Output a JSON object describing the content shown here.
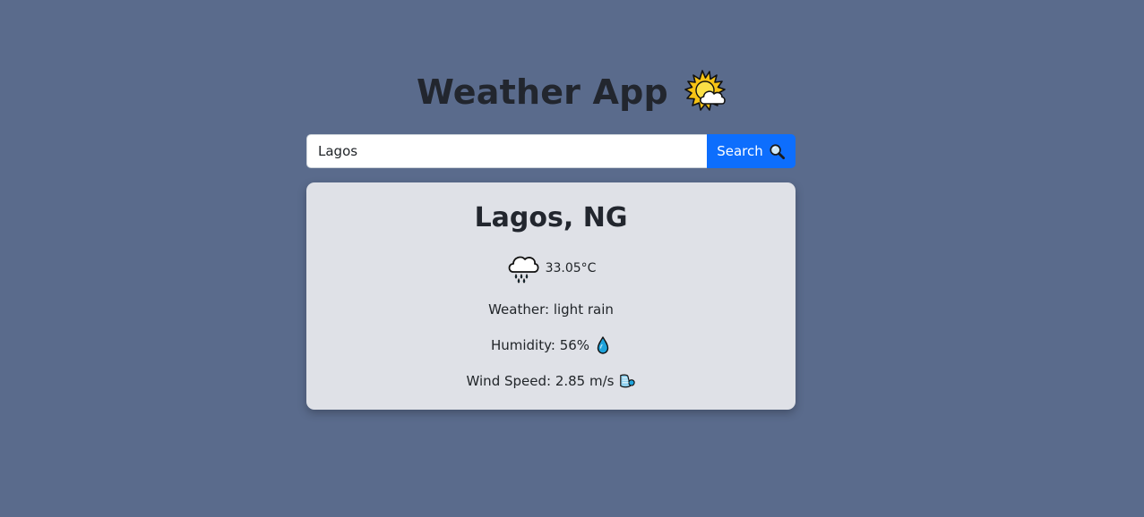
{
  "header": {
    "title": "Weather App",
    "logo_icon": "sun-behind-cloud-icon"
  },
  "search": {
    "value": "Lagos",
    "button_label": "Search",
    "button_icon": "magnifier-icon",
    "button_color": "#0d6efd"
  },
  "weather": {
    "city": "Lagos, NG",
    "condition_icon": "cloud-with-rain-icon",
    "temperature": "33.05°C",
    "description": "Weather: light rain",
    "humidity": "Humidity: 56%",
    "humidity_icon": "droplet-icon",
    "wind_speed": "Wind Speed: 2.85 m/s",
    "wind_icon": "wind-icon"
  },
  "colors": {
    "background": "#5a6b8c",
    "card": "#dfe1e7",
    "accent": "#0d6efd"
  }
}
